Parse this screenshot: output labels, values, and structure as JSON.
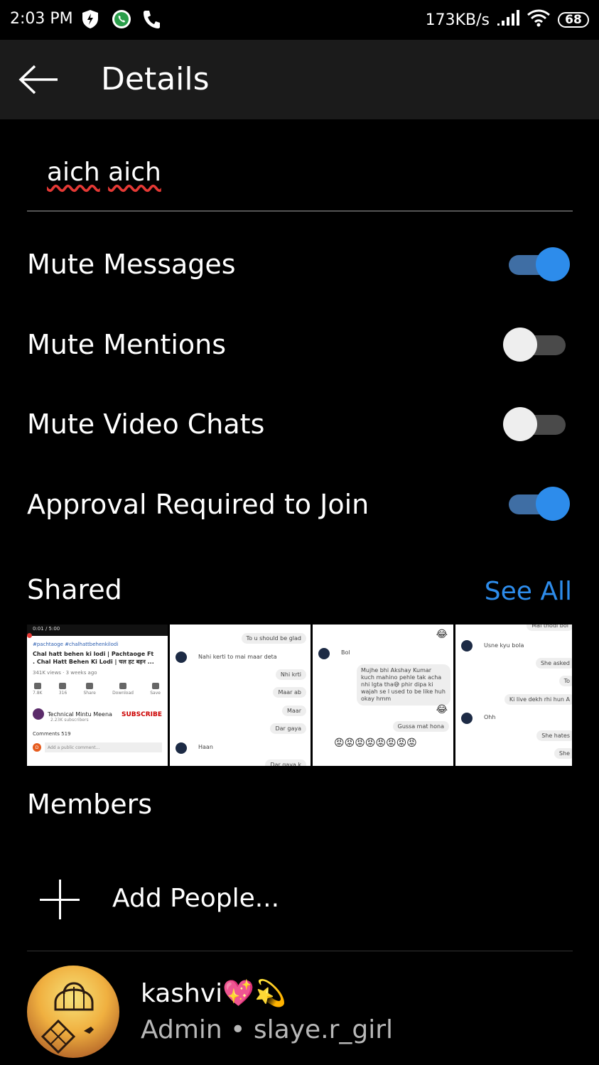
{
  "status_bar": {
    "time": "2:03 PM",
    "net_speed": "173KB/s",
    "battery": "68",
    "icons": [
      "shield-bolt-icon",
      "whatsapp-icon",
      "phone-icon",
      "signal-icon",
      "wifi-icon",
      "battery-icon"
    ]
  },
  "app_bar": {
    "title": "Details",
    "back_icon": "arrow-left-icon"
  },
  "group": {
    "name_word_1": "aich",
    "name_word_2": "aich"
  },
  "settings": {
    "mute_messages": {
      "label": "Mute Messages",
      "on": true
    },
    "mute_mentions": {
      "label": "Mute Mentions",
      "on": false
    },
    "mute_video_chats": {
      "label": "Mute Video Chats",
      "on": false
    },
    "approval_required": {
      "label": "Approval Required to Join",
      "on": true
    }
  },
  "shared": {
    "title": "Shared",
    "see_all": "See All",
    "thumbnails": {
      "t1": {
        "time": "0:01 / 5:00",
        "tags": "#pachtaoge #chalhattbehenkilodi",
        "title": "Chal hatt behen ki lodi | Pachtaoge Ft . Chal Hatt Behen Ki Lodi | चल हट बहन ...",
        "views": "341K views · 3 weeks ago",
        "actions": [
          "7.8K",
          "316",
          "Share",
          "Download",
          "Save"
        ],
        "channel": "Technical Mintu Meena",
        "subs": "2.23K subscribers",
        "subscribe": "SUBSCRIBE",
        "comments": "Comments  519",
        "comment_avatar": "D",
        "add_comment": "Add a public comment..."
      },
      "t2": {
        "m1": "To u should be glad",
        "m2": "Nahi kerti to mai maar deta",
        "m3": "Nhi krti",
        "m4": "Maar ab",
        "m5": "Maar",
        "m6": "Dar gaya",
        "m7": "Haan",
        "m8": "Dar gaya k"
      },
      "t3": {
        "m1": "Bol",
        "m2": "Mujhe bhi Akshay Kumar kuch mahino pehle tak acha nhi lgta tha😅 phir dipa ki wajah se l used to be like huh okay hmm",
        "m3": "Gussa mat hona",
        "emoji_laugh": "😂",
        "angry": "😡😡😡😡😡😡😡😡"
      },
      "t4": {
        "m0": "Mai thodi bol",
        "m1": "Usne kyu bola",
        "m2": "She asked",
        "m3": "To",
        "m4": "Ki live dekh rhi hun A",
        "m5": "Ohh",
        "m6": "She hates",
        "m7": "She"
      }
    }
  },
  "members": {
    "title": "Members",
    "add_label": "Add People...",
    "list": [
      {
        "name": "kashvi💖💫",
        "sub": "Admin • slaye.r_girl",
        "avatar_icon": "birdcage-sunset-avatar"
      }
    ]
  },
  "colors": {
    "accent": "#2d8ceb",
    "background": "#000000",
    "appbar": "#1b1b1b"
  }
}
